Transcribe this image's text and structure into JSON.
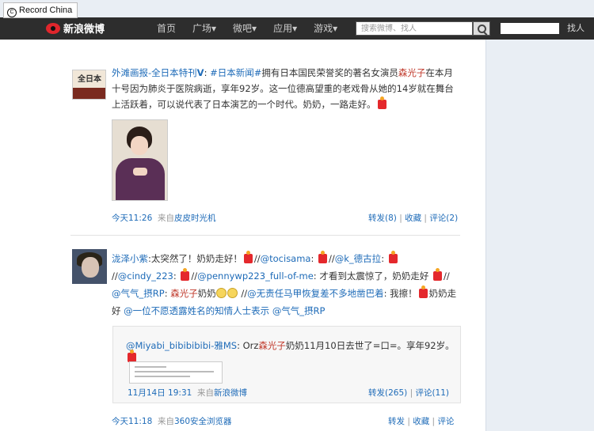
{
  "watermark": {
    "symbol": "C",
    "text": "Record China"
  },
  "topbar": {
    "logo": "新浪微博",
    "nav": [
      "首页",
      "广场▾",
      "微吧▾",
      "应用▾",
      "游戏▾"
    ],
    "search_placeholder": "搜索微博、找人",
    "find_people": "找人"
  },
  "post1": {
    "avatar_text": "全日本",
    "author": "外滩画报-全日本特刊",
    "badge": "V",
    "colon": ":",
    "tag1": "#日本新闻#",
    "text_a": "拥有日本国民荣誉奖的著名女演员",
    "highlight": "森光子",
    "text_b": "在本月十号因为肺炎于医院病逝，享年92岁。这一位德高望重的老戏骨从她的14岁就在舞台上活跃着，可以说代表了日本演艺的一个时代。奶奶，一路走好。",
    "time": "今天11:26",
    "from_label": "来自",
    "from_app": "皮皮时光机",
    "repost": "转发(8)",
    "fav": "收藏",
    "comment": "评论(2)"
  },
  "post2": {
    "author": "泷泽小紫",
    "t1": ":太突然了！奶奶走好！",
    "s1": "//",
    "m1": "@tocisama",
    "t2": ":",
    "s2": "//",
    "m2": "@k_德古拉",
    "t3": ":",
    "s3": "//",
    "m3": "@cindy_223",
    "t4": ":",
    "s4": "//",
    "m4": "@pennywp223_full-of-me",
    "t5": ": 才看到太震惊了，奶奶走好",
    "s5": "//",
    "m5": "@气气_摂RP",
    "t6": ":",
    "hl": "森光子",
    "t7": "奶奶",
    "s6": "//",
    "m6": "@无责任马甲恢复差不多地凿巴着",
    "t8": ": 我擦！",
    "t9": "奶奶走好",
    "m7": "@一位不愿透露姓名的知情人士表示",
    "m8": "@气气_摂RP",
    "time": "今天11:18",
    "from_label": "来自",
    "from_app": "360安全浏览器",
    "repost": "转发",
    "fav": "收藏",
    "comment": "评论"
  },
  "quote": {
    "author": "@Miyabi_bibibibibi-雅MS",
    "t1": ": Orz",
    "hl": "森光子",
    "t2": "奶奶11月10日去世了=口=。享年92岁。",
    "time": "11月14日 19:31",
    "from_label": "来自",
    "from_app": "新浪微博",
    "repost": "转发(265)",
    "comment": "评论(11)"
  }
}
